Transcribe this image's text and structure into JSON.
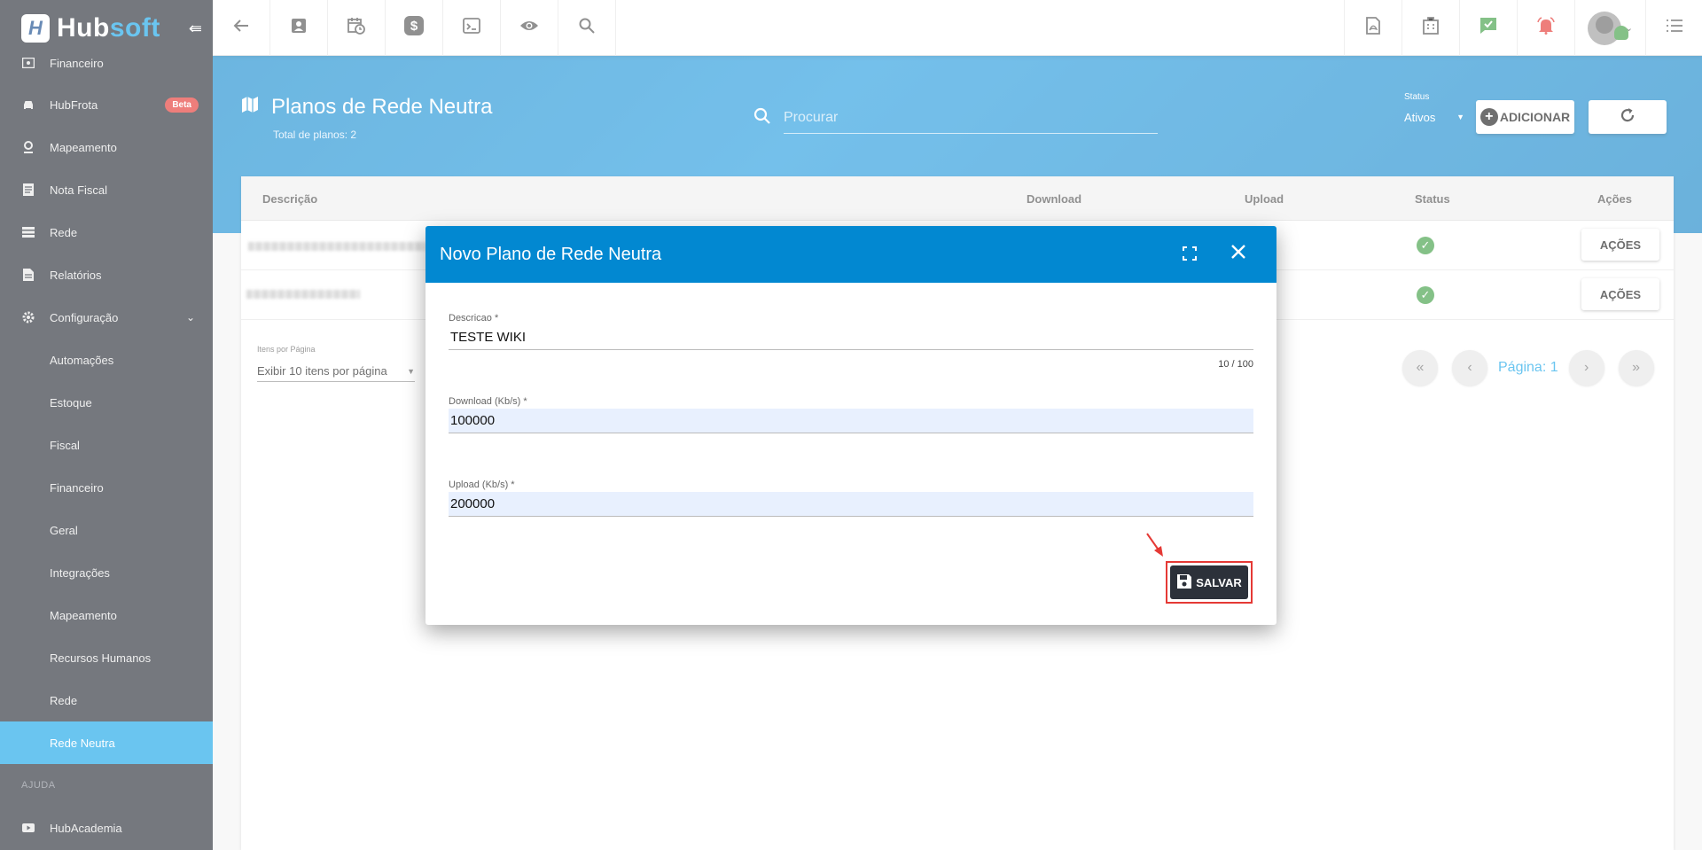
{
  "brand": {
    "hub": "Hub",
    "soft": "soft",
    "collapse_glyph": "⇚"
  },
  "sidebar": {
    "items": [
      {
        "label": "Financeiro",
        "icon": "money-icon"
      },
      {
        "label": "HubFrota",
        "icon": "car-icon",
        "badge": "Beta"
      },
      {
        "label": "Mapeamento",
        "icon": "map-pin-icon"
      },
      {
        "label": "Nota Fiscal",
        "icon": "receipt-icon"
      },
      {
        "label": "Rede",
        "icon": "server-icon"
      },
      {
        "label": "Relatórios",
        "icon": "report-icon"
      },
      {
        "label": "Configuração",
        "icon": "gear-icon"
      }
    ],
    "sub_items": [
      "Automações",
      "Estoque",
      "Fiscal",
      "Financeiro",
      "Geral",
      "Integrações",
      "Mapeamento",
      "Recursos Humanos",
      "Rede",
      "Rede Neutra"
    ],
    "active": "Rede Neutra",
    "section_help": "AJUDA",
    "help_item": {
      "label": "HubAcademia",
      "icon": "youtube-icon"
    }
  },
  "topbar": {
    "left_icons": [
      "back-arrow-icon",
      "contact-card-icon",
      "calendar-clock-icon",
      "dollar-icon",
      "terminal-icon",
      "eye-icon",
      "search-icon"
    ],
    "right_icons": [
      "pdf-icon",
      "building-icon",
      "chat-check-icon",
      "alarm-bell-icon"
    ],
    "menu_icon": "list-menu-icon"
  },
  "page": {
    "title": "Planos de Rede Neutra",
    "subtitle": "Total de planos: 2",
    "search_placeholder": "Procurar",
    "status_label": "Status",
    "status_value": "Ativos",
    "add_label": "ADICIONAR"
  },
  "table": {
    "headers": [
      "Descrição",
      "Download",
      "Upload",
      "Status",
      "Ações"
    ],
    "rows": [
      {
        "status": "active",
        "action": "AÇÕES"
      },
      {
        "status": "active",
        "action": "AÇÕES"
      }
    ],
    "per_page_label": "Itens por Página",
    "per_page_value": "Exibir 10 itens por página",
    "page_label": "Página: 1"
  },
  "dialog": {
    "title": "Novo Plano de Rede Neutra",
    "fields": [
      {
        "label": "Descricao *",
        "value": "TESTE WIKI",
        "counter": "10 / 100"
      },
      {
        "label": "Download (Kb/s) *",
        "value": "100000"
      },
      {
        "label": "Upload (Kb/s) *",
        "value": "200000"
      }
    ],
    "save_label": "SALVAR"
  },
  "colors": {
    "accent": "#1ba6e8",
    "header_blue": "#0288d1",
    "sidebar": "#2c313a",
    "success": "#43a047",
    "danger": "#e53935"
  }
}
